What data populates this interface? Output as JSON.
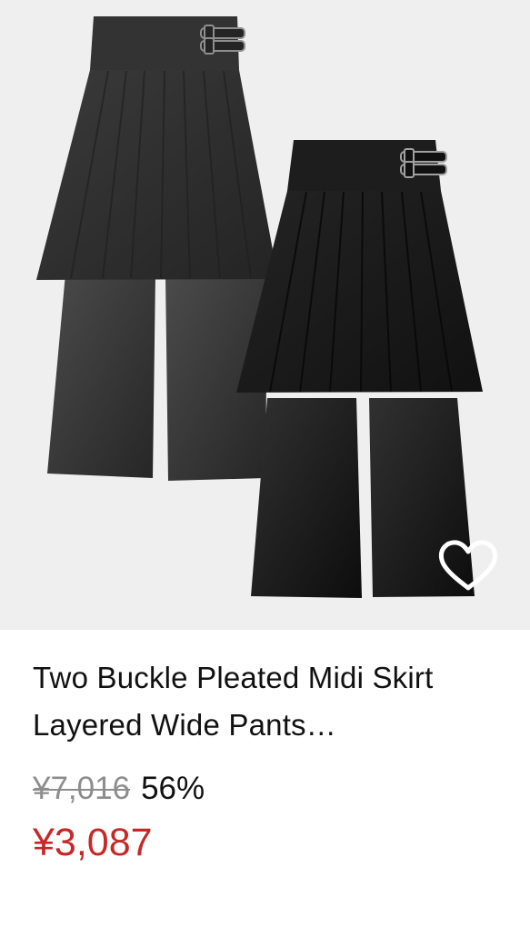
{
  "product": {
    "title": "Two Buckle Pleated Midi Skirt Layered Wide Pants…",
    "original_price": "¥7,016",
    "discount": "56%",
    "sale_price": "¥3,087"
  },
  "favorite": {
    "icon": "heart-outline-icon"
  },
  "colors": {
    "background": "#ffffff",
    "image_background": "#efefef",
    "text": "#111111",
    "strikethrough": "#8d8d8d",
    "sale": "#c62828",
    "garment_front": "#292929",
    "garment_back": "#3b3b3b"
  }
}
